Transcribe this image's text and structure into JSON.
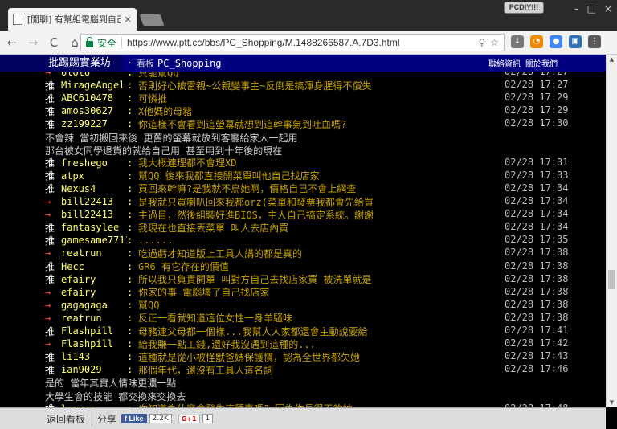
{
  "browser": {
    "tab_title": "[閒聊] 有幫組電腦到自己",
    "tab_close": "×",
    "profile_badge": "PCDIY!!!",
    "window_controls": [
      "–",
      "□",
      "×"
    ],
    "secure_label": "安全",
    "url": "https://www.ptt.cc/bbs/PC_Shopping/M.1488266587.A.7D3.html",
    "nav": {
      "back": "←",
      "forward": "→",
      "reload": "C",
      "home": "⌂"
    },
    "ext_colors": [
      "#777777",
      "#f08a00",
      "#4285f4",
      "#2d6fb5",
      "#5b5b5b"
    ]
  },
  "header": {
    "brand": "批踢踢實業坊",
    "separator": "›",
    "board_label": "看板",
    "board_name": "PC_Shopping",
    "links": [
      "聯絡資訊",
      "關於我們"
    ]
  },
  "pushes": [
    {
      "tag": "→",
      "kind": "arrow",
      "user": "olQlo",
      "text": "只能幫QQ",
      "time": "02/28 17:27"
    },
    {
      "tag": "推",
      "kind": "push",
      "user": "MirageAngel",
      "text": "否則好心被雷親~公親變事主~反倒是搞渾身腥得不償失",
      "time": "02/28 17:27"
    },
    {
      "tag": "推",
      "kind": "push",
      "user": "ABC610478",
      "text": "可憐推",
      "time": "02/28 17:29"
    },
    {
      "tag": "推",
      "kind": "push",
      "user": "amos30627",
      "text": "X他媽的母豬",
      "time": "02/28 17:29"
    },
    {
      "tag": "推",
      "kind": "push",
      "user": "zz199227",
      "text": "你這樣不會看到這螢幕就想到這幹事氣到吐血嗎?",
      "time": "02/28 17:30"
    },
    {
      "tag": "推",
      "kind": "push",
      "user": "freshego",
      "text": "我大概連理都不會理XD",
      "time": "02/28 17:31"
    },
    {
      "tag": "推",
      "kind": "push",
      "user": "atpx",
      "text": "幫QQ 後來我都直接開菜單叫他自己找店家",
      "time": "02/28 17:33"
    },
    {
      "tag": "推",
      "kind": "push",
      "user": "Nexus4",
      "text": "買回來幹嘛?是我就不鳥她啊，價格自己不會上網查",
      "time": "02/28 17:34"
    },
    {
      "tag": "→",
      "kind": "arrow",
      "user": "bill22413",
      "text": "是我就只買喇叭回來我都orz(菜單和發票我都會先給買",
      "time": "02/28 17:34"
    },
    {
      "tag": "→",
      "kind": "arrow",
      "user": "bill22413",
      "text": "主過目，然後組裝好進BIOS，主人自己搞定系統。謝謝",
      "time": "02/28 17:34"
    },
    {
      "tag": "推",
      "kind": "push",
      "user": "fantasylee",
      "text": "我現在也直接丟菜單 叫人去店內買",
      "time": "02/28 17:34"
    },
    {
      "tag": "推",
      "kind": "push",
      "user": "gamesame7711",
      "text": "......",
      "time": "02/28 17:35"
    },
    {
      "tag": "→",
      "kind": "arrow",
      "user": "reatrun",
      "text": "吃過虧才知道版上工具人講的都是真的",
      "time": "02/28 17:38"
    },
    {
      "tag": "推",
      "kind": "push",
      "user": "Hecc",
      "text": "GR6 有它存在的價值",
      "time": "02/28 17:38"
    },
    {
      "tag": "推",
      "kind": "push",
      "user": "efairy",
      "text": "所以我只負責開單 叫對方自己去找店家買 被洗單就是",
      "time": "02/28 17:38"
    },
    {
      "tag": "→",
      "kind": "arrow",
      "user": "efairy",
      "text": "你家的事 電腦壞了自己找店家",
      "time": "02/28 17:38"
    },
    {
      "tag": "→",
      "kind": "arrow",
      "user": "gagagaga",
      "text": "幫QQ",
      "time": "02/28 17:38"
    },
    {
      "tag": "→",
      "kind": "arrow",
      "user": "reatrun",
      "text": "反正一看就知道這位女性一身羊騷味",
      "time": "02/28 17:38"
    },
    {
      "tag": "推",
      "kind": "push",
      "user": "Flashpill",
      "text": "母豬連父母都一個樣...我幫人人家都還會主動說要給",
      "time": "02/28 17:41"
    },
    {
      "tag": "→",
      "kind": "arrow",
      "user": "Flashpill",
      "text": "給我賺一點工錢,還好我沒遇到這種的...",
      "time": "02/28 17:42"
    },
    {
      "tag": "推",
      "kind": "push",
      "user": "li143",
      "text": "這種就是從小被怪獸爸媽保護慣，認為全世界都欠她",
      "time": "02/28 17:43"
    },
    {
      "tag": "推",
      "kind": "push",
      "user": "ian9029",
      "text": "那個年代，還沒有工具人這名詞",
      "time": "02/28 17:46"
    },
    {
      "tag": "推",
      "kind": "push",
      "user": "locuss",
      "text": "你知道為什麼會發生這種事嗎? 因為你長得不夠帥",
      "time": "02/28 17:48"
    }
  ],
  "plain_lines": [
    "不會辣 當初搬回來後 更舊的螢幕就放到客廳給家人一起用",
    "那台被女同學退貨的就給自己用 甚至用到十年後的現在",
    "是的 當年其實人情味更濃一點",
    "大學生會的技能 都交換來交換去"
  ],
  "scrollbar": {
    "up": "▲",
    "down": "▼"
  },
  "footer": {
    "back": "返回看板",
    "share": "分享",
    "fb_like": "f Like",
    "fb_count": "2.2K",
    "gplus": "G+1",
    "gplus_count": "1"
  }
}
